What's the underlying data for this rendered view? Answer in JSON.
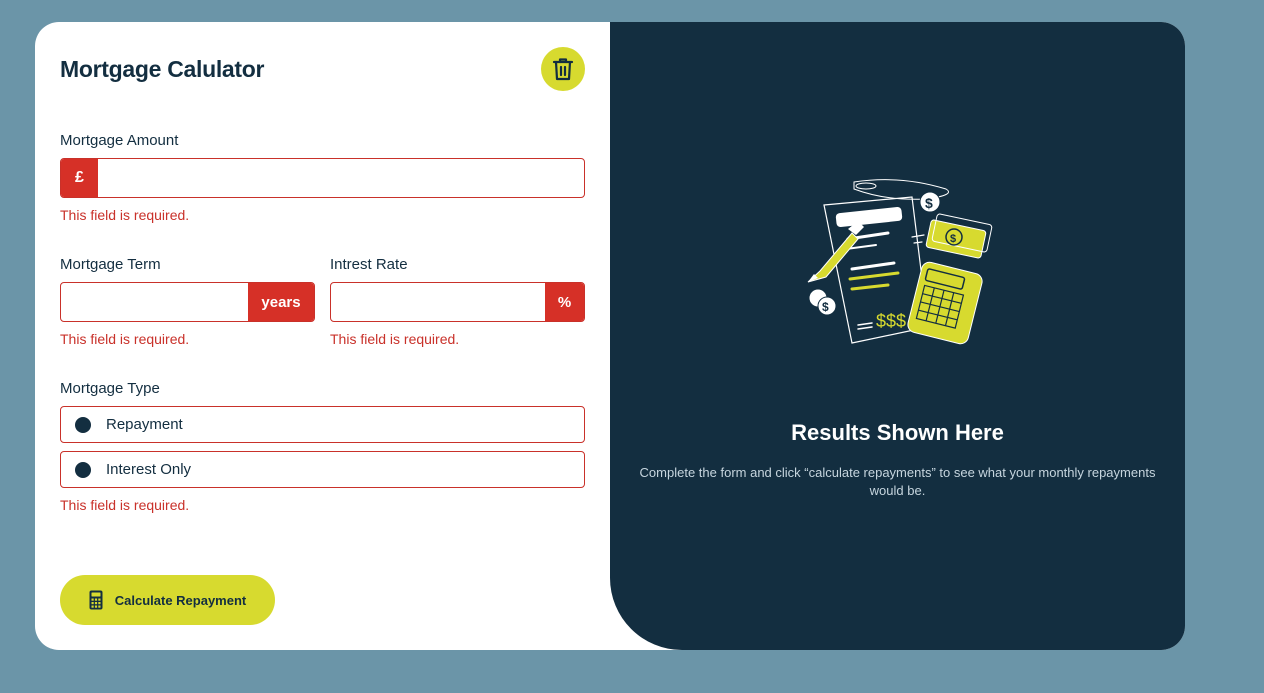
{
  "form": {
    "title": "Mortgage Calulator",
    "amount": {
      "label": "Mortgage Amount",
      "prefix": "£",
      "value": "",
      "error": "This field is required."
    },
    "term": {
      "label": "Mortgage Term",
      "suffix": "years",
      "value": "",
      "error": "This field is required."
    },
    "rate": {
      "label": "Intrest Rate",
      "suffix": "%",
      "value": "",
      "error": "This field is required."
    },
    "type": {
      "label": "Mortgage Type",
      "options": [
        {
          "label": "Repayment"
        },
        {
          "label": "Interest Only"
        }
      ],
      "error": "This field is required."
    },
    "submit_label": "Calculate Repayment"
  },
  "results": {
    "title": "Results Shown Here",
    "text": "Complete the form and click “calculate repayments” to see what your monthly repayments would be."
  },
  "colors": {
    "page_bg": "#6b95a8",
    "panel_dark": "#132e40",
    "accent_lime": "#d7da2f",
    "error_red": "#c9312a"
  },
  "icons": {
    "clear": "trash-icon",
    "submit": "calculator-icon",
    "illustration": "empty-results-illustration"
  }
}
